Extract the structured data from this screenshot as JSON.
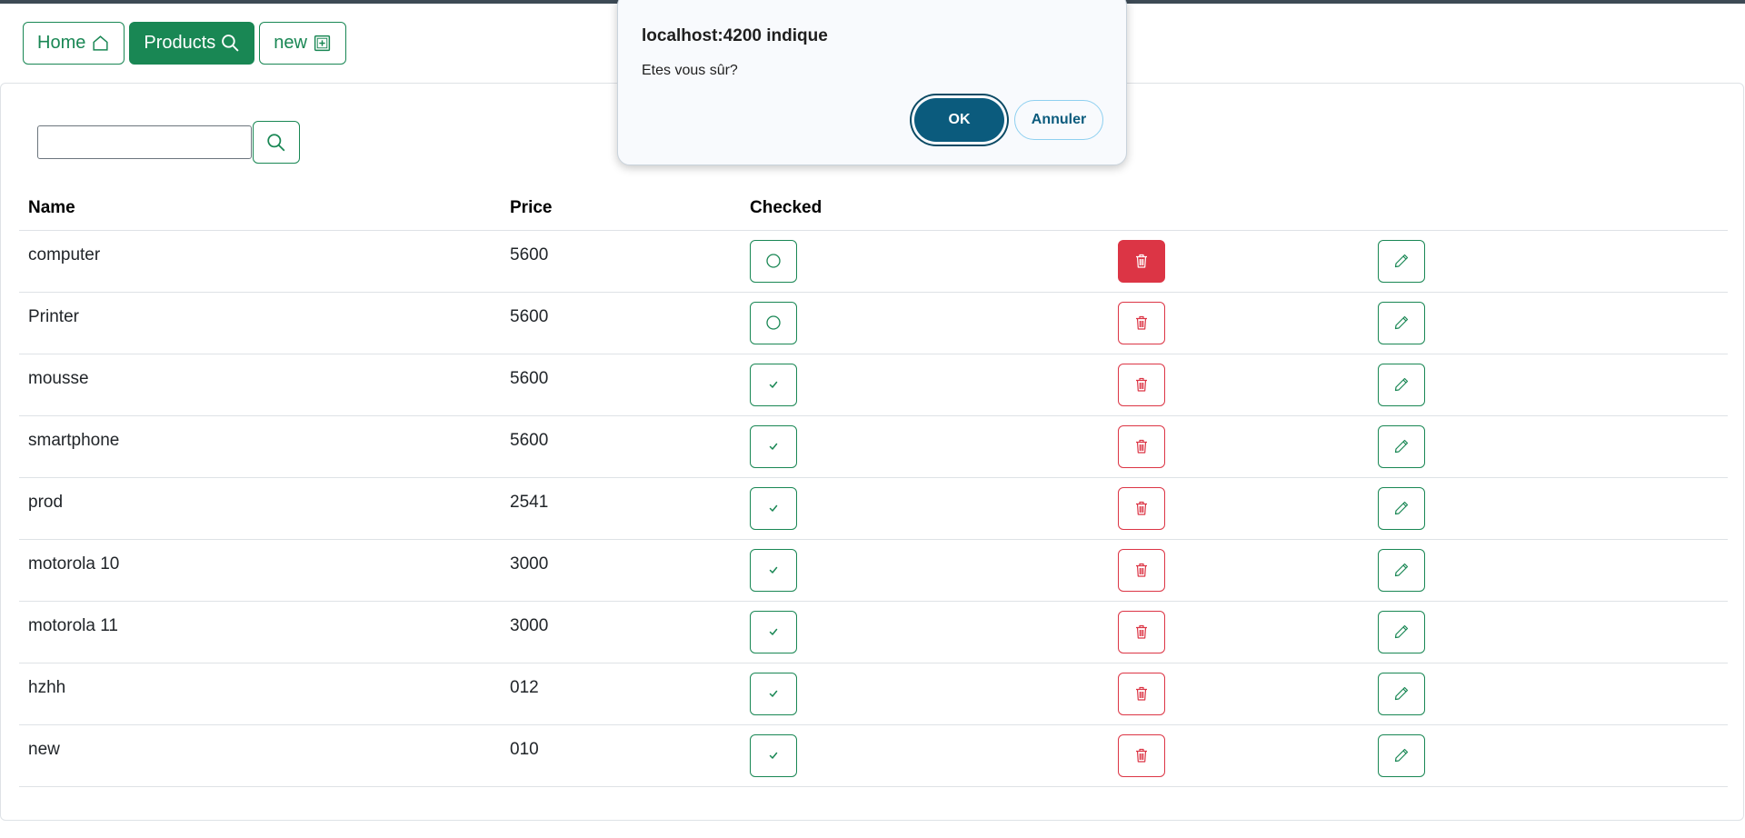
{
  "nav": {
    "home_label": "Home",
    "products_label": "Products",
    "new_label": "new"
  },
  "search": {
    "value": "",
    "placeholder": ""
  },
  "table": {
    "headers": {
      "name": "Name",
      "price": "Price",
      "checked": "Checked"
    },
    "rows": [
      {
        "name": "computer",
        "price": "5600",
        "checked": false
      },
      {
        "name": "Printer",
        "price": "5600",
        "checked": false
      },
      {
        "name": "mousse",
        "price": "5600",
        "checked": true
      },
      {
        "name": "smartphone",
        "price": "5600",
        "checked": true
      },
      {
        "name": "prod",
        "price": "2541",
        "checked": true
      },
      {
        "name": "motorola 10",
        "price": "3000",
        "checked": true
      },
      {
        "name": "motorola 11",
        "price": "3000",
        "checked": true
      },
      {
        "name": "hzhh",
        "price": "012",
        "checked": true
      },
      {
        "name": "new",
        "price": "010",
        "checked": true
      }
    ]
  },
  "dialog": {
    "title": "localhost:4200 indique",
    "message": "Etes vous sûr?",
    "ok_label": "OK",
    "cancel_label": "Annuler"
  },
  "colors": {
    "success": "#198754",
    "danger": "#dc3545",
    "dialog_primary": "#0b5b7d"
  },
  "icons": {
    "home": "house-icon",
    "products": "search-icon",
    "new": "plus-square-icon",
    "search": "search-icon",
    "unchecked": "circle-icon",
    "checked": "check-icon",
    "delete": "trash-icon",
    "edit": "pencil-icon"
  }
}
